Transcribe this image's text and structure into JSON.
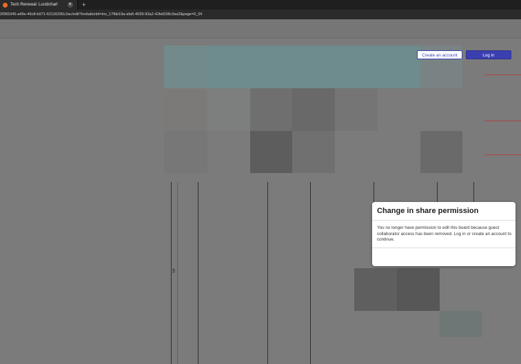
{
  "browser": {
    "tab_title": "Tech Renewal: Lucidchart",
    "url": "2f365345-a49e-46c8-b971-62116230c2ac/edit?invitationId=inv_17fbb19a-afa5-4039-93a2-42bd158c3aa2&page=0_0#"
  },
  "board": {
    "lane_label": "VA"
  },
  "modal": {
    "title": "Change in share permission",
    "body": "You no longer have permission to edit this board because guest collaborator access has been removed. Log in or create an account to continue.",
    "create_account_label": "Create an account",
    "login_label": "Log in"
  },
  "colors": {
    "accent": "#3b3fb0",
    "tab_favicon": "#f06a2a"
  }
}
